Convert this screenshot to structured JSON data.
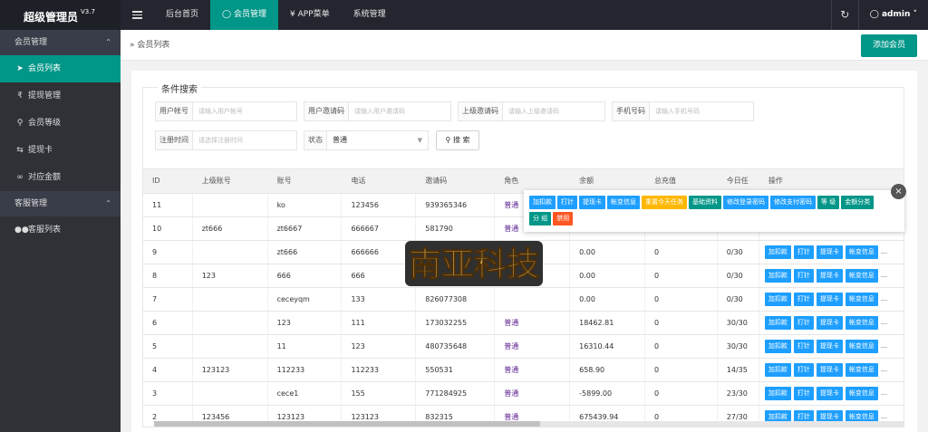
{
  "app": {
    "title": "超级管理员",
    "version": "V3.7"
  },
  "topnav": {
    "items": [
      {
        "label": "后台首页",
        "icon": ""
      },
      {
        "label": "会员管理",
        "icon": "user-icon"
      },
      {
        "label": "APP菜单",
        "icon": "yen-icon"
      },
      {
        "label": "系统管理",
        "icon": ""
      }
    ],
    "user": "admin"
  },
  "sidebar": {
    "group1": "会员管理",
    "items1": [
      {
        "label": "会员列表",
        "icon": "rocket-icon"
      },
      {
        "label": "提现管理",
        "icon": "rupee-icon"
      },
      {
        "label": "会员等级",
        "icon": "key-icon"
      },
      {
        "label": "提现卡",
        "icon": "swap-icon"
      },
      {
        "label": "对应金额",
        "icon": "link-icon"
      }
    ],
    "group2": "客服管理",
    "items2": [
      {
        "label": "客服列表",
        "icon": "users-icon"
      }
    ]
  },
  "breadcrumb": "会员列表",
  "add_button": "添加会员",
  "search": {
    "legend": "条件搜索",
    "fields": [
      {
        "label": "用户帐号",
        "placeholder": "请输入用户帐号"
      },
      {
        "label": "用户邀请码",
        "placeholder": "请输入用户邀请码"
      },
      {
        "label": "上级邀请码",
        "placeholder": "请输入上级邀请码"
      },
      {
        "label": "手机号码",
        "placeholder": "请输入手机号码"
      },
      {
        "label": "注册时间",
        "placeholder": "请选择注册时间"
      }
    ],
    "status_label": "状态",
    "status_value": "普通",
    "button": "搜 索"
  },
  "table": {
    "headers": [
      "ID",
      "上级账号",
      "账号",
      "电话",
      "邀请码",
      "角色",
      "余额",
      "总充值",
      "今日任",
      "操作"
    ],
    "rows": [
      [
        "11",
        "",
        "ko",
        "123456",
        "939365346",
        "普通",
        "",
        "",
        ""
      ],
      [
        "10",
        "zt666",
        "zt6667",
        "666667",
        "581790",
        "普通",
        "",
        "",
        ""
      ],
      [
        "9",
        "",
        "zt666",
        "666666",
        "",
        "",
        "0.00",
        "0",
        "0/30"
      ],
      [
        "8",
        "123",
        "666",
        "666",
        "",
        "",
        "0.00",
        "0",
        "0/30"
      ],
      [
        "7",
        "",
        "ceceyqm",
        "133",
        "826077308",
        "",
        "0.00",
        "0",
        "0/30"
      ],
      [
        "6",
        "",
        "123",
        "111",
        "173032255",
        "普通",
        "18462.81",
        "0",
        "30/30"
      ],
      [
        "5",
        "",
        "11",
        "123",
        "480735648",
        "普通",
        "16310.44",
        "0",
        "30/30"
      ],
      [
        "4",
        "123123",
        "112233",
        "112233",
        "550531",
        "普通",
        "658.90",
        "0",
        "14/35"
      ],
      [
        "3",
        "",
        "cece1",
        "155",
        "771284925",
        "普通",
        "-5899.00",
        "0",
        "23/30"
      ],
      [
        "2",
        "123456",
        "123123",
        "123123",
        "832315",
        "普通",
        "675439.94",
        "0",
        "27/30"
      ]
    ],
    "row_ops": [
      "加扣款",
      "打针",
      "提现卡",
      "帐变信息"
    ],
    "more": "..."
  },
  "popup": {
    "buttons": [
      {
        "label": "加扣款",
        "color": "blue"
      },
      {
        "label": "打针",
        "color": "blue"
      },
      {
        "label": "提现卡",
        "color": "blue"
      },
      {
        "label": "帐变信息",
        "color": "blue"
      },
      {
        "label": "重置今天任务",
        "color": "orange"
      },
      {
        "label": "基础资料",
        "color": "green"
      },
      {
        "label": "修改登录密码",
        "color": "blue"
      },
      {
        "label": "修改支付密码",
        "color": "blue"
      },
      {
        "label": "等 级",
        "color": "green"
      },
      {
        "label": "金额分类",
        "color": "green"
      },
      {
        "label": "分 组",
        "color": "green"
      },
      {
        "label": "禁用",
        "color": "red"
      }
    ]
  },
  "colors": {
    "accent": "#009688",
    "blue": "#1e9fff",
    "orange": "#ffb800",
    "red": "#ff5722",
    "topbar": "#23262e",
    "sidebar": "#2f3137"
  }
}
